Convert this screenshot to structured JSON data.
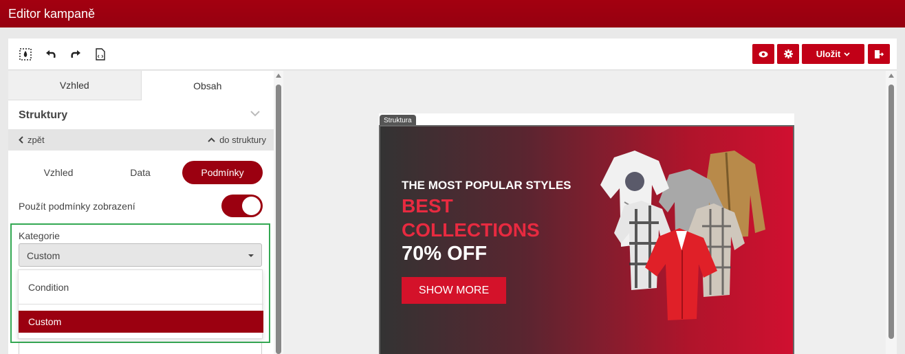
{
  "app": {
    "title": "Editor kampaně"
  },
  "toolbar": {
    "tools": [
      "select-region-icon",
      "undo-icon",
      "redo-icon",
      "html-code-icon"
    ],
    "buttons": [
      "eye-icon",
      "gear-icon",
      "save-dropdown",
      "exit-icon"
    ],
    "save_label": "Uložit"
  },
  "panel": {
    "tabs": [
      {
        "label": "Vzhled",
        "active": false
      },
      {
        "label": "Obsah",
        "active": true
      }
    ],
    "section_title": "Struktury",
    "nav": {
      "back": "zpět",
      "to_structure": "do struktury"
    },
    "subtabs": [
      {
        "label": "Vzhled",
        "active": false
      },
      {
        "label": "Data",
        "active": false
      },
      {
        "label": "Podmínky",
        "active": true
      }
    ],
    "toggle": {
      "label": "Použít podmínky zobrazení",
      "on": true
    },
    "category": {
      "label": "Kategorie",
      "value": "Custom",
      "options": [
        {
          "label": "Condition",
          "selected": false
        },
        {
          "label": "Custom",
          "selected": true
        }
      ]
    }
  },
  "canvas": {
    "structure_tag": "Struktura",
    "banner": {
      "subtitle": "THE MOST POPULAR STYLES",
      "title": "BEST COLLECTIONS",
      "offer": "70% OFF",
      "button": "SHOW MORE"
    }
  },
  "colors": {
    "brand": "#9b0010",
    "accent": "#d4122a",
    "highlight": "#33a852"
  }
}
